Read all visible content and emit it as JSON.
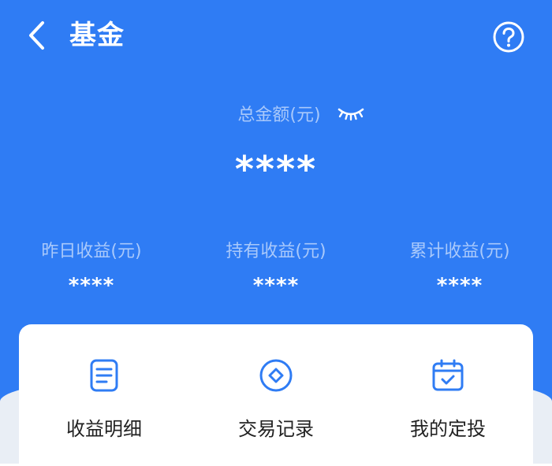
{
  "header": {
    "title": "基金",
    "back_icon": "chevron-left-icon",
    "help_icon": "question-circle-icon"
  },
  "summary": {
    "total_label": "总金额(元)",
    "total_value": "****",
    "visibility_icon": "eye-closed-icon"
  },
  "stats": [
    {
      "label": "昨日收益(元)",
      "value": "****"
    },
    {
      "label": "持有收益(元)",
      "value": "****"
    },
    {
      "label": "累计收益(元)",
      "value": "****"
    }
  ],
  "actions": [
    {
      "label": "收益明细",
      "icon": "document-list-icon"
    },
    {
      "label": "交易记录",
      "icon": "transaction-diamond-icon"
    },
    {
      "label": "我的定投",
      "icon": "calendar-check-icon"
    }
  ],
  "colors": {
    "primary": "#2f7cf4",
    "label_light": "#a9c9fb",
    "text_dark": "#222222",
    "card": "#ffffff"
  }
}
